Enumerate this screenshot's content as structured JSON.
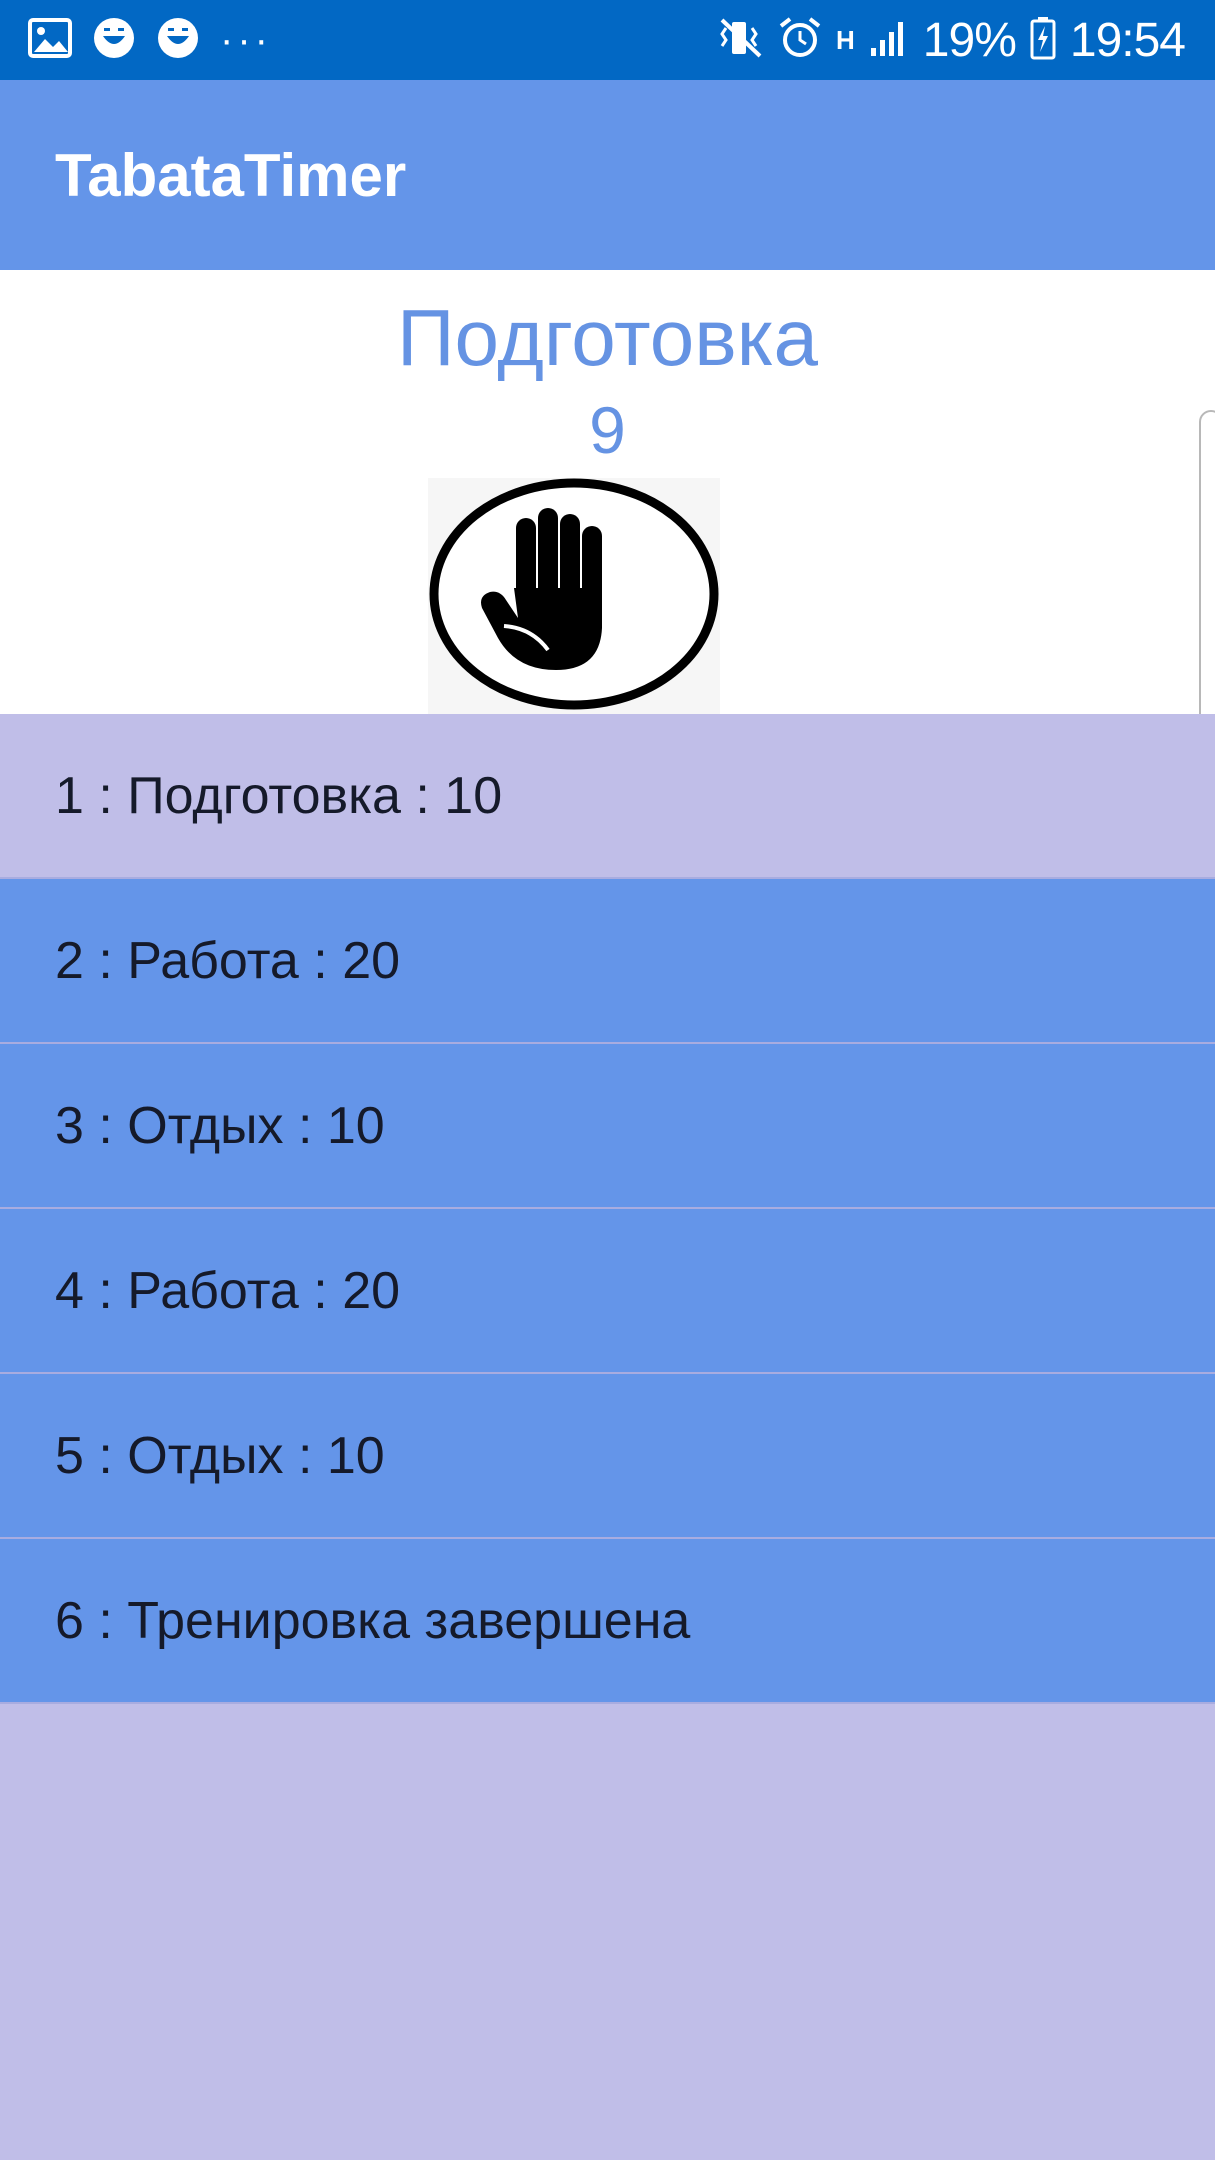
{
  "status_bar": {
    "battery": "19%",
    "time": "19:54",
    "network": "H",
    "left_icons": [
      "gallery-icon",
      "smiley-icon",
      "smiley-icon",
      "more-notifications-icon"
    ],
    "right_icons": [
      "vibrate-icon",
      "alarm-icon",
      "network-type-icon",
      "signal-icon",
      "battery-icon"
    ]
  },
  "app_bar": {
    "title": "TabataTimer"
  },
  "current": {
    "phase": "Подготовка",
    "count": "9",
    "icon": "stop-hand-icon"
  },
  "colors": {
    "status_bar": "#0268C4",
    "app_bar": "#6495E9",
    "accent_text": "#6593E3",
    "active_row": "#C0BEE8",
    "row": "#6495E9"
  },
  "steps": [
    {
      "label": "1 : Подготовка : 10",
      "active": true
    },
    {
      "label": "2 : Работа : 20",
      "active": false
    },
    {
      "label": "3 : Отдых : 10",
      "active": false
    },
    {
      "label": "4 : Работа : 20",
      "active": false
    },
    {
      "label": "5 : Отдых : 10",
      "active": false
    },
    {
      "label": "6 : Тренировка завершена",
      "active": false
    }
  ]
}
